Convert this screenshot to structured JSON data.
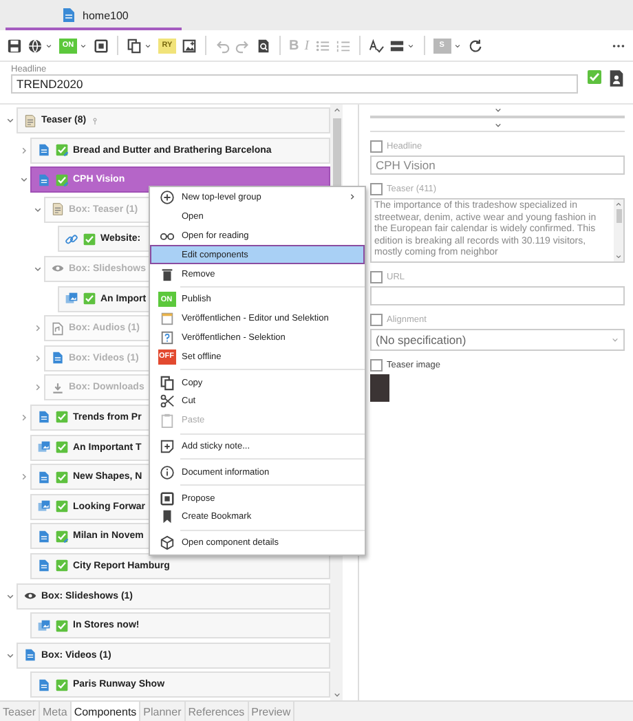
{
  "tab": {
    "title": "home100",
    "selected": true
  },
  "toolbar": [
    {
      "kind": "save",
      "disabled": false,
      "dropdown": false
    },
    {
      "kind": "globe",
      "disabled": false,
      "dropdown": true
    },
    {
      "kind": "badge",
      "label": "ON",
      "color": "#5cc83c",
      "disabled": false,
      "dropdown": true
    },
    {
      "kind": "media",
      "disabled": false,
      "dropdown": false
    },
    {
      "kind": "separator"
    },
    {
      "kind": "copy",
      "disabled": false,
      "dropdown": true
    },
    {
      "kind": "badge",
      "label": "RY",
      "color": "#f1e37a",
      "disabled": false,
      "dropdown": false
    },
    {
      "kind": "image-add",
      "disabled": false,
      "dropdown": false
    },
    {
      "kind": "separator"
    },
    {
      "kind": "undo",
      "disabled": true,
      "dropdown": false
    },
    {
      "kind": "redo",
      "disabled": true,
      "dropdown": false
    },
    {
      "kind": "preview",
      "disabled": false,
      "dropdown": false
    },
    {
      "kind": "separator"
    },
    {
      "kind": "bold",
      "label": "B",
      "disabled": true,
      "dropdown": false
    },
    {
      "kind": "italic",
      "label": "I",
      "disabled": true,
      "dropdown": false
    },
    {
      "kind": "bullets",
      "disabled": true,
      "dropdown": false
    },
    {
      "kind": "numbers",
      "disabled": true,
      "dropdown": false
    },
    {
      "kind": "separator"
    },
    {
      "kind": "spellcheck",
      "disabled": false,
      "dropdown": false
    },
    {
      "kind": "lines",
      "disabled": false,
      "dropdown": true
    },
    {
      "kind": "separator"
    },
    {
      "kind": "badge",
      "label": "S",
      "color": "#b9b9b9",
      "disabled": false,
      "dropdown": true
    },
    {
      "kind": "refresh",
      "disabled": false,
      "dropdown": false
    },
    {
      "kind": "more",
      "disabled": false,
      "dropdown": false
    }
  ],
  "headline": {
    "label": "Headline",
    "value": "TREND2020"
  },
  "tree": [
    {
      "label": "Teaser (8)",
      "kind": "teaser-box",
      "pinned": true,
      "expanded": true,
      "selected": false,
      "disabled": false,
      "children": [
        {
          "label": "Bread and Butter and Brathering Barcelona",
          "kind": "article",
          "approved": true,
          "modified": true,
          "pinned": false,
          "expanded": false,
          "selected": false,
          "disabled": false
        },
        {
          "label": "CPH Vision",
          "kind": "article",
          "approved": true,
          "modified": true,
          "pinned": false,
          "expanded": true,
          "selected": true,
          "disabled": false,
          "children": [
            {
              "label": "Box: Teaser (1)",
              "kind": "teaser-box",
              "pinned": false,
              "expanded": true,
              "selected": false,
              "disabled": true,
              "children": [
                {
                  "label": "Website:",
                  "kind": "link",
                  "approved": true,
                  "modified": false,
                  "pinned": false,
                  "selected": false,
                  "disabled": false
                }
              ]
            },
            {
              "label": "Box: Slideshows",
              "kind": "slideshow-box",
              "pinned": false,
              "expanded": true,
              "selected": false,
              "disabled": true,
              "children": [
                {
                  "label": "An Import",
                  "kind": "gallery",
                  "approved": true,
                  "modified": false,
                  "pinned": false,
                  "selected": false,
                  "disabled": false
                }
              ]
            },
            {
              "label": "Box: Audios (1)",
              "kind": "audio-box",
              "pinned": false,
              "expanded": false,
              "selected": false,
              "disabled": true
            },
            {
              "label": "Box: Videos (1)",
              "kind": "video-box",
              "pinned": false,
              "expanded": false,
              "selected": false,
              "disabled": true
            },
            {
              "label": "Box: Downloads",
              "kind": "download-box",
              "pinned": false,
              "expanded": false,
              "selected": false,
              "disabled": true
            }
          ]
        },
        {
          "label": "Trends from Pr",
          "kind": "article",
          "approved": true,
          "modified": false,
          "pinned": false,
          "expanded": false,
          "selected": false,
          "disabled": false
        },
        {
          "label": "An Important T",
          "kind": "gallery",
          "approved": true,
          "modified": false,
          "pinned": false,
          "selected": false,
          "disabled": false
        },
        {
          "label": "New Shapes, N",
          "kind": "article",
          "approved": true,
          "modified": false,
          "pinned": false,
          "expanded": false,
          "selected": false,
          "disabled": false
        },
        {
          "label": "Looking Forwar",
          "kind": "gallery",
          "approved": true,
          "modified": false,
          "pinned": false,
          "selected": false,
          "disabled": false
        },
        {
          "label": "Milan in Novem",
          "kind": "article",
          "approved": true,
          "modified": true,
          "pinned": false,
          "selected": false,
          "disabled": false
        },
        {
          "label": "City Report Hamburg",
          "kind": "article",
          "approved": true,
          "modified": false,
          "pinned": false,
          "selected": false,
          "disabled": false
        }
      ]
    },
    {
      "label": "Box: Slideshows (1)",
      "kind": "slideshow-box",
      "pinned": false,
      "expanded": true,
      "selected": false,
      "disabled": false,
      "children": [
        {
          "label": "In Stores now!",
          "kind": "gallery",
          "approved": true,
          "modified": false,
          "pinned": false,
          "selected": false,
          "disabled": false
        }
      ]
    },
    {
      "label": "Box: Videos (1)",
      "kind": "video-box",
      "pinned": false,
      "expanded": true,
      "selected": false,
      "disabled": false,
      "children": [
        {
          "label": "Paris Runway Show",
          "kind": "article",
          "approved": true,
          "modified": false,
          "pinned": false,
          "selected": false,
          "disabled": false
        }
      ]
    }
  ],
  "context_menu": {
    "groups": [
      [
        {
          "label": "New top-level group",
          "kind": "plus",
          "submenu": true,
          "selected": false,
          "disabled": false
        },
        {
          "label": "Open",
          "kind": "plain",
          "selected": false,
          "disabled": false
        },
        {
          "label": "Open for reading",
          "kind": "glasses",
          "selected": false,
          "disabled": false
        },
        {
          "label": "Edit components",
          "kind": "plain",
          "selected": true,
          "disabled": false
        },
        {
          "label": "Remove",
          "kind": "trash",
          "selected": false,
          "disabled": false
        }
      ],
      [
        {
          "label": "Publish",
          "kind": "badge",
          "badge": "ON",
          "color": "#5cc83c",
          "selected": false,
          "disabled": false
        },
        {
          "label": "Veröffentlichen - Editor und Selektion",
          "kind": "calendar",
          "selected": false,
          "disabled": false
        },
        {
          "label": "Veröffentlichen - Selektion",
          "kind": "question",
          "selected": false,
          "disabled": false
        },
        {
          "label": "Set offline",
          "kind": "badge",
          "badge": "OFF",
          "color": "#e2492f",
          "selected": false,
          "disabled": false
        }
      ],
      [
        {
          "label": "Copy",
          "kind": "copy",
          "selected": false,
          "disabled": false
        },
        {
          "label": "Cut",
          "kind": "cut",
          "selected": false,
          "disabled": false
        },
        {
          "label": "Paste",
          "kind": "paste",
          "selected": false,
          "disabled": true
        }
      ],
      [
        {
          "label": "Add sticky note...",
          "kind": "sticky",
          "selected": false,
          "disabled": false
        }
      ],
      [
        {
          "label": "Document information",
          "kind": "info",
          "selected": false,
          "disabled": false
        }
      ],
      [
        {
          "label": "Propose",
          "kind": "media",
          "selected": false,
          "disabled": false
        },
        {
          "label": "Create Bookmark",
          "kind": "bookmark",
          "selected": false,
          "disabled": false
        }
      ],
      [
        {
          "label": "Open component details",
          "kind": "cube",
          "selected": false,
          "disabled": false
        }
      ]
    ]
  },
  "fields": [
    {
      "kind": "text",
      "label": "Headline",
      "checked": false,
      "disabled": true,
      "value": "CPH Vision"
    },
    {
      "kind": "textarea",
      "label": "Teaser (411)",
      "checked": false,
      "disabled": true,
      "value": "The importance of this tradeshow specialized in streetwear, denim, active wear and young fashion in the European fair calendar is widely confirmed. This edition is breaking all records with 30.119 visitors, mostly coming from neighbor"
    },
    {
      "kind": "text",
      "label": "URL",
      "checked": false,
      "disabled": true
    },
    {
      "kind": "select",
      "label": "Alignment",
      "checked": false,
      "disabled": true,
      "value": "(No specification)"
    },
    {
      "kind": "image",
      "label": "Teaser image",
      "checked": false,
      "disabled": false
    }
  ],
  "bottom_tabs": [
    {
      "label": "Teaser",
      "selected": false
    },
    {
      "label": "Meta",
      "selected": false
    },
    {
      "label": "Components",
      "selected": true
    },
    {
      "label": "Planner",
      "selected": false
    },
    {
      "label": "References",
      "selected": false
    },
    {
      "label": "Preview",
      "selected": false
    }
  ]
}
